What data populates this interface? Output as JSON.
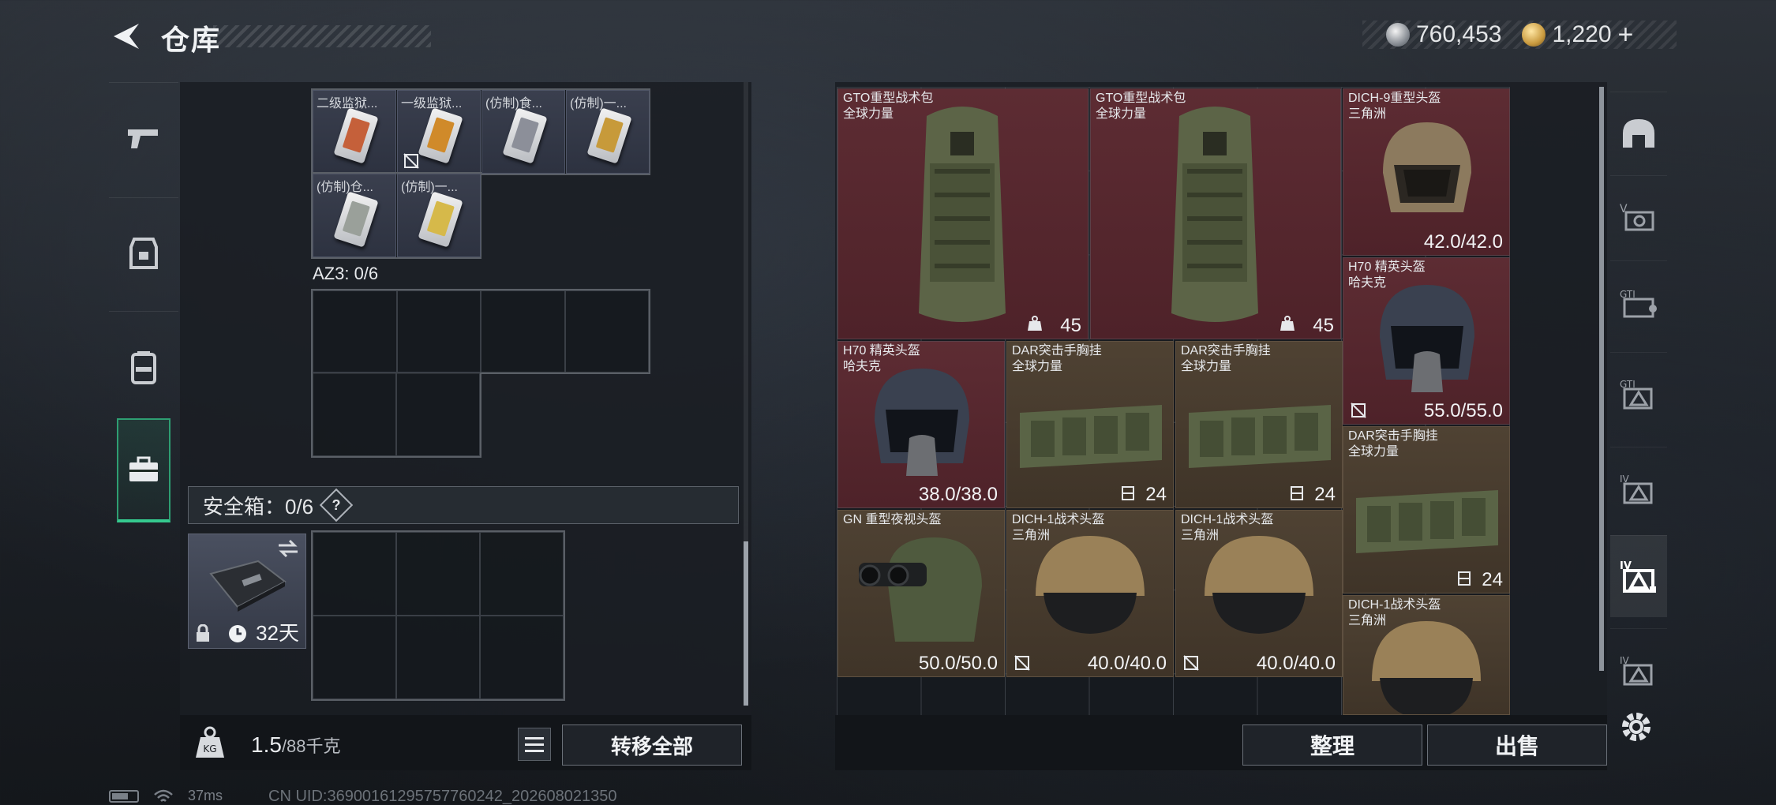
{
  "header": {
    "title": "仓库",
    "currency": {
      "silver_amount": "760,453",
      "gold_amount": "1,220",
      "gold_add": "+"
    }
  },
  "left_tabs": [
    {
      "icon": "pistol-icon"
    },
    {
      "icon": "armor-vest-icon"
    },
    {
      "icon": "backpack-icon"
    },
    {
      "icon": "toolbox-icon",
      "active": true
    }
  ],
  "left_panel": {
    "key_slots": [
      {
        "label": "二级监狱..."
      },
      {
        "label": "一级监狱..."
      },
      {
        "label": "(仿制)食..."
      },
      {
        "label": "(仿制)一..."
      },
      {
        "label": "(仿制)仓..."
      },
      {
        "label": "(仿制)一..."
      }
    ],
    "az3_label": "AZ3: 0/6",
    "safebox_label": "安全箱：0/6",
    "safebox_help": "?",
    "safebox_duration": "32天",
    "weight_current": "1.5",
    "weight_max": "/88千克",
    "transfer_all": "转移全部"
  },
  "stash_items": [
    {
      "name1": "GTO重型战术包",
      "name2": "全球力量",
      "value": "45"
    },
    {
      "name1": "GTO重型战术包",
      "name2": "全球力量",
      "value": "45"
    },
    {
      "name1": "DICH-9重型头盔",
      "name2": "三角洲",
      "value": "42.0/42.0"
    },
    {
      "name1": "H70 精英头盔",
      "name2": "哈夫克",
      "value": "55.0/55.0"
    },
    {
      "name1": "H70 精英头盔",
      "name2": "哈夫克",
      "value": "38.0/38.0"
    },
    {
      "name1": "DAR突击手胸挂",
      "name2": "全球力量",
      "value": "24"
    },
    {
      "name1": "DAR突击手胸挂",
      "name2": "全球力量",
      "value": "24"
    },
    {
      "name1": "DAR突击手胸挂",
      "name2": "全球力量",
      "value": "24"
    },
    {
      "name1": "GN 重型夜视头盔",
      "name2": "",
      "value": "50.0/50.0"
    },
    {
      "name1": "DICH-1战术头盔",
      "name2": "三角洲",
      "value": "40.0/40.0"
    },
    {
      "name1": "DICH-1战术头盔",
      "name2": "三角洲",
      "value": "40.0/40.0"
    },
    {
      "name1": "DICH-1战术头盔",
      "name2": "三角洲",
      "value": ""
    }
  ],
  "right_bottom": {
    "sort_label": "整理",
    "sell_label": "出售"
  },
  "right_tabs": [
    {
      "icon": "stash-arch-icon"
    },
    {
      "icon": "stash-v-icon"
    },
    {
      "icon": "stash-gti-icon"
    },
    {
      "icon": "stash-gti-triangle-icon"
    },
    {
      "icon": "stash-iv-icon"
    },
    {
      "icon": "stash-iv-active-icon",
      "active": true
    },
    {
      "icon": "stash-iv-2-icon"
    }
  ],
  "status": {
    "ping": "37ms",
    "uid": "CN UID:36900161295757760242_202608021350"
  }
}
